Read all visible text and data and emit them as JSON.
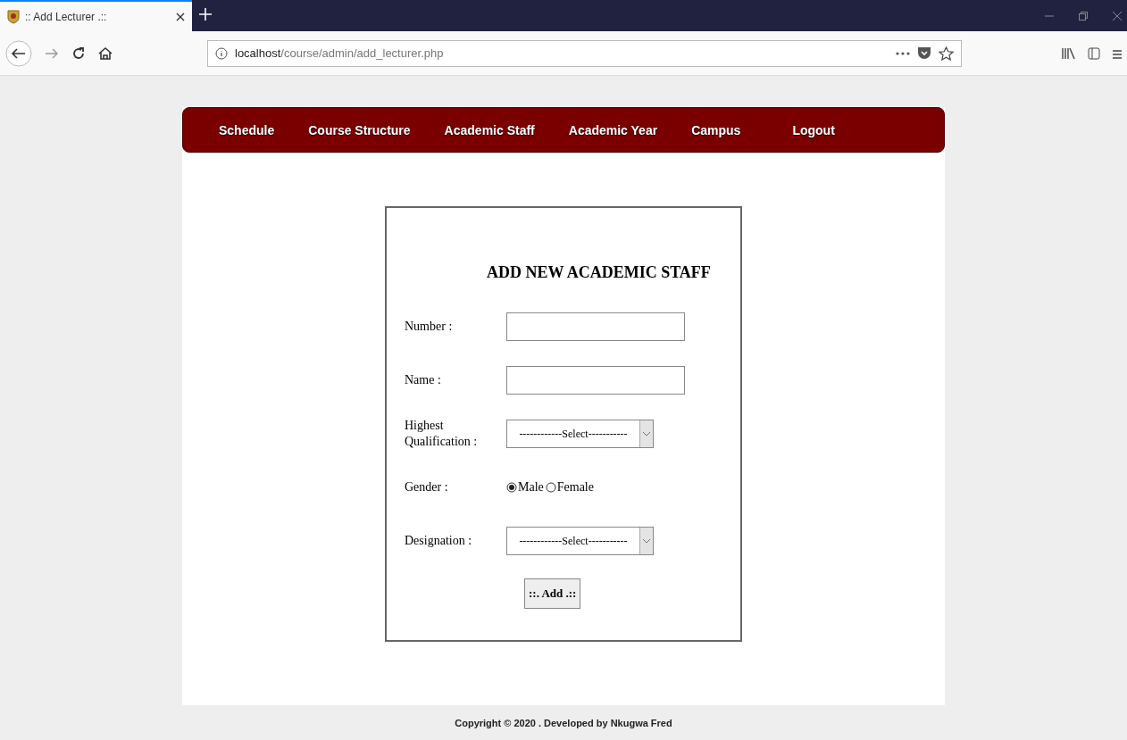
{
  "browser": {
    "tab_title": ":: Add Lecturer .::",
    "url_host": "localhost",
    "url_path": "/course/admin/add_lecturer.php"
  },
  "nav": [
    {
      "label": "Schedule"
    },
    {
      "label": "Course Structure"
    },
    {
      "label": "Academic Staff"
    },
    {
      "label": "Academic Year"
    },
    {
      "label": "Campus"
    },
    {
      "label": "Logout"
    }
  ],
  "form": {
    "title": "ADD NEW ACADEMIC STAFF",
    "fields": [
      {
        "kind": "text",
        "label": "Number :"
      },
      {
        "kind": "text",
        "label": "Name :"
      },
      {
        "kind": "select",
        "label": "Highest Qualification :",
        "value": "------------Select-----------"
      },
      {
        "kind": "radio",
        "label": "Gender :",
        "options": [
          {
            "label": "Male",
            "selected": true
          },
          {
            "label": "Female",
            "selected": false
          }
        ]
      },
      {
        "kind": "select",
        "label": "Designation :",
        "value": "------------Select-----------"
      }
    ],
    "submit": "::. Add .::"
  },
  "footer": "Copyright © 2020 . Developed by Nkugwa Fred"
}
